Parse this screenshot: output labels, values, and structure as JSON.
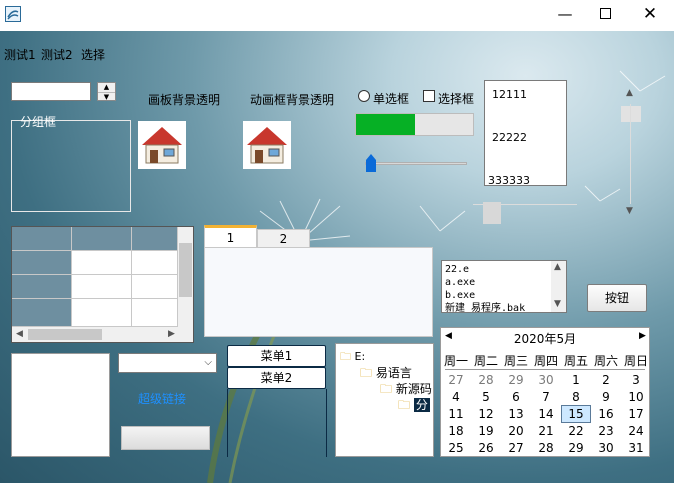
{
  "menu": [
    {
      "label": "测试1"
    },
    {
      "label": "测试2"
    },
    {
      "label": "选择"
    }
  ],
  "labels": {
    "canvas_transparent": "画板背景透明",
    "anim_transparent": "动画框背景透明",
    "group_box": "分组框",
    "hyperlink": "超级链接"
  },
  "controls": {
    "radio_label": "单选框",
    "checkbox_label": "选择框",
    "button_label": "按钮",
    "menu_button_1": "菜单1",
    "menu_button_2": "菜单2",
    "progress_fraction": 0.5,
    "slider_fraction": 0.02,
    "h_scroll_fraction": 0.12,
    "v_scroll_fraction": 0.05
  },
  "listbox": {
    "items": [
      "12111",
      "22222",
      "333333"
    ]
  },
  "tabs": [
    {
      "label": "1"
    },
    {
      "label": "2"
    }
  ],
  "file_list": {
    "items": [
      "22.e",
      "a.exe",
      "b.exe",
      "新建 易程序.bak"
    ]
  },
  "tree": {
    "items": [
      "E:",
      "易语言",
      "新源码",
      "分"
    ]
  },
  "calendar": {
    "title": "2020年5月",
    "weekdays": [
      "周一",
      "周二",
      "周三",
      "周四",
      "周五",
      "周六",
      "周日"
    ],
    "weeks": [
      [
        "27",
        "28",
        "29",
        "30",
        "1",
        "2",
        "3"
      ],
      [
        "4",
        "5",
        "6",
        "7",
        "8",
        "9",
        "10"
      ],
      [
        "11",
        "12",
        "13",
        "14",
        "15",
        "16",
        "17"
      ],
      [
        "18",
        "19",
        "20",
        "21",
        "22",
        "23",
        "24"
      ],
      [
        "25",
        "26",
        "27",
        "28",
        "29",
        "30",
        "31"
      ]
    ],
    "selected": "15"
  },
  "colors": {
    "progress": "#06b025",
    "link": "#1e90ff",
    "slider_thumb": "#0a6ad8"
  }
}
